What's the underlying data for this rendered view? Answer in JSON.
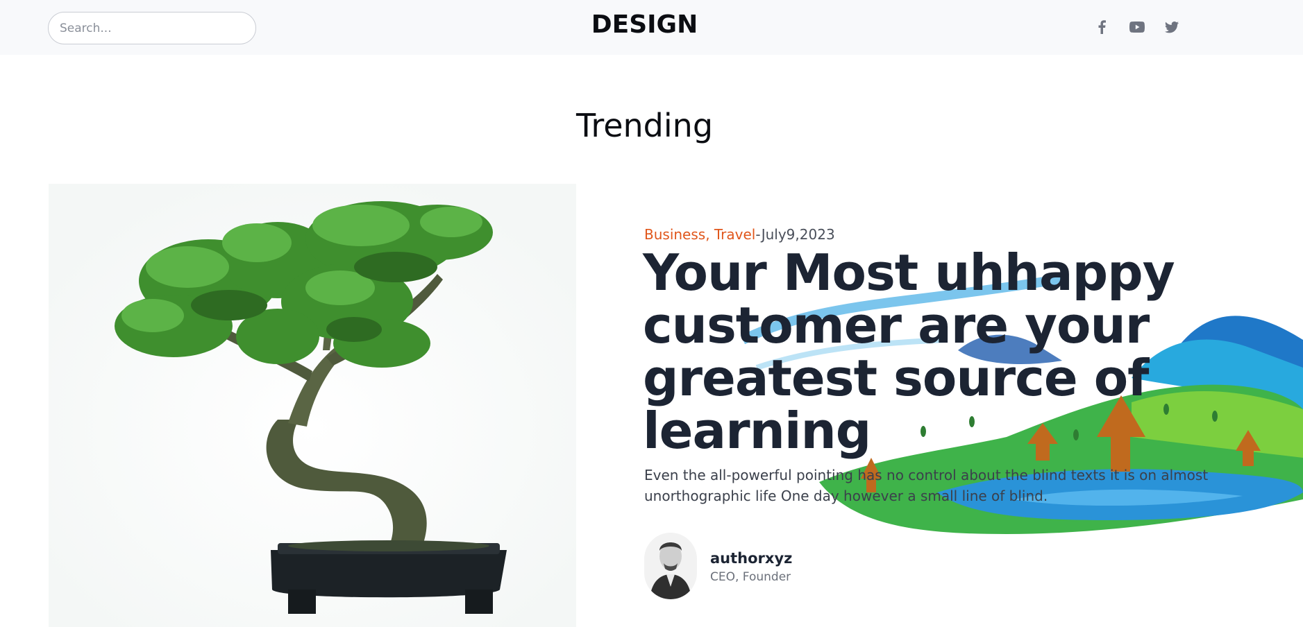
{
  "header": {
    "search_placeholder": "Search...",
    "brand": "DESIGN",
    "social": [
      "facebook-icon",
      "youtube-icon",
      "twitter-icon"
    ]
  },
  "section": {
    "title": "Trending"
  },
  "post": {
    "categories": "Business, Travel",
    "separator": "-",
    "date": "July9,2023",
    "title": "Your Most uhhappy customer are your greatest source of learning",
    "summary": "Even the all-powerful pointing has no control about the blind texts it is on almost unorthographic life One day however a small line of blind.",
    "author": {
      "name": "authorxyz",
      "role": "CEO, Founder"
    }
  },
  "colors": {
    "accent": "#e0561b",
    "heading": "#1c2433",
    "topbar": "#f8f9fb"
  }
}
